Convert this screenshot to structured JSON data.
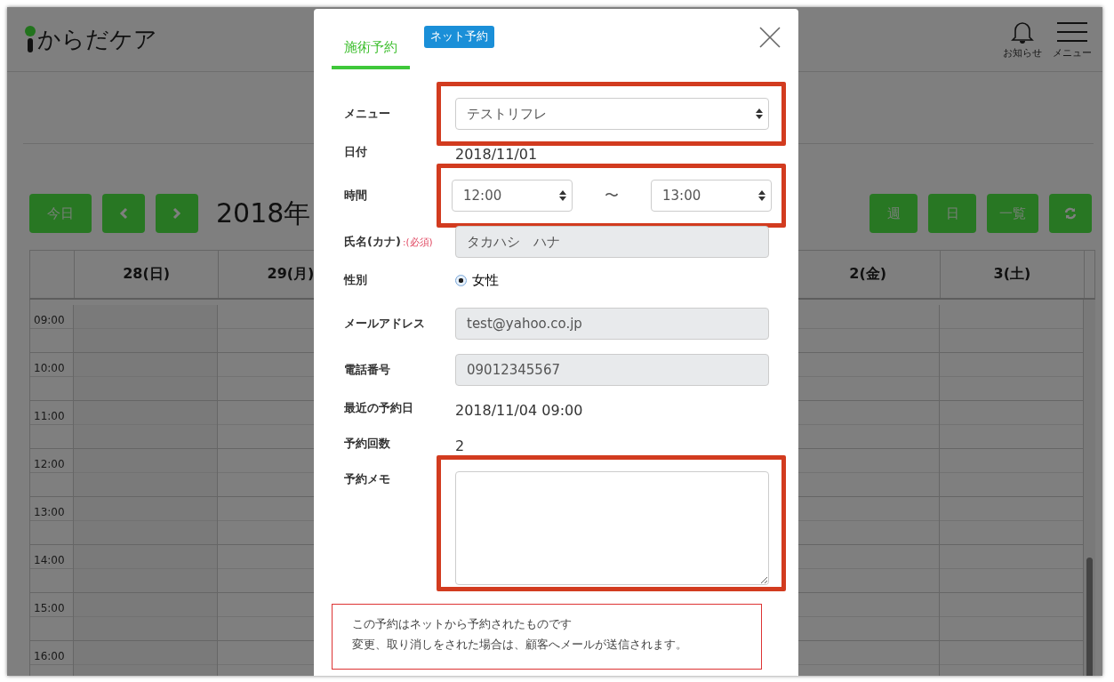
{
  "header": {
    "logo": "からだケア",
    "actions": [
      {
        "kind": "bell",
        "label": "お知らせ"
      },
      {
        "kind": "menu",
        "label": "メニュー"
      }
    ]
  },
  "toolbar": {
    "left_buttons": [
      {
        "kind": "text",
        "label": "今日"
      },
      {
        "kind": "prev"
      },
      {
        "kind": "next"
      }
    ],
    "title": "2018年",
    "right_buttons": [
      {
        "kind": "text",
        "label": "週"
      },
      {
        "kind": "text",
        "label": "日"
      },
      {
        "kind": "text",
        "label": "一覧"
      },
      {
        "kind": "refresh"
      }
    ]
  },
  "calendar": {
    "days_left": [
      "28(日)",
      "29(月)"
    ],
    "days_right": [
      "2(金)",
      "3(土)"
    ],
    "times": [
      "09:00",
      "10:00",
      "11:00",
      "12:00",
      "13:00",
      "14:00",
      "15:00",
      "16:00"
    ]
  },
  "modal": {
    "tabs": [
      {
        "label": "施術予約",
        "selected": true
      }
    ],
    "source_badge": "ネット予約",
    "fields": [
      {
        "kind": "select",
        "label": "メニュー",
        "value": "テストリフレ",
        "highlighted": true
      },
      {
        "kind": "text",
        "label": "日付",
        "value": "2018/11/01"
      },
      {
        "kind": "time_range",
        "label": "時間",
        "from": "12:00",
        "separator": "〜",
        "to": "13:00",
        "highlighted": true
      },
      {
        "kind": "input",
        "label": "氏名(カナ)",
        "required_note": ":(必須)",
        "value": "タカハシ　ハナ",
        "disabled": true
      },
      {
        "kind": "radio",
        "label": "性別",
        "options": [
          {
            "label": "女性",
            "selected": true
          }
        ]
      },
      {
        "kind": "input",
        "label": "メールアドレス",
        "value": "test@yahoo.co.jp",
        "disabled": true
      },
      {
        "kind": "input",
        "label": "電話番号",
        "value": "09012345567",
        "disabled": true
      },
      {
        "kind": "text",
        "label": "最近の予約日",
        "value": "2018/11/04 09:00"
      },
      {
        "kind": "text",
        "label": "予約回数",
        "value": "2"
      },
      {
        "kind": "textarea",
        "label": "予約メモ",
        "highlighted": true
      }
    ],
    "notice": [
      "この予約はネットから予約されたものです",
      "変更、取り消しをされた場合は、顧客へメールが送信されます。"
    ]
  }
}
